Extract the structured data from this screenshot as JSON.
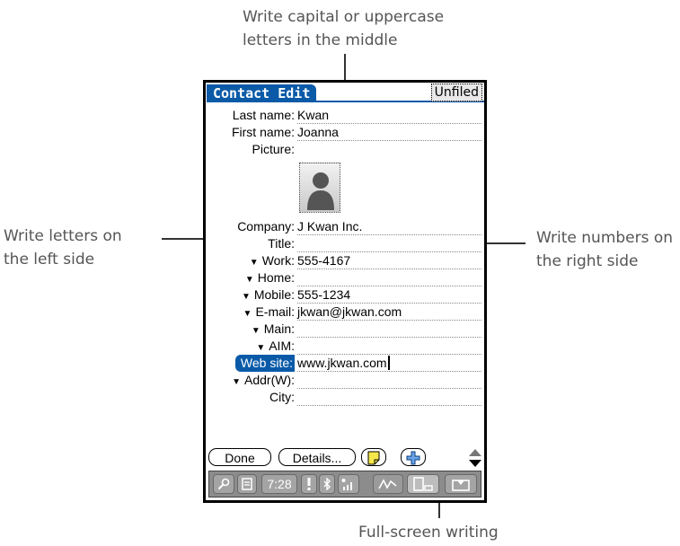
{
  "callouts": {
    "top": "Write capital or uppercase\nletters in the middle",
    "left": "Write letters on\nthe left side",
    "right": "Write numbers on\nthe right side",
    "bottom": "Full-screen writing"
  },
  "header": {
    "title": "Contact Edit",
    "category": "Unfiled"
  },
  "fields": [
    {
      "label": "Last name:",
      "value": "Kwan",
      "dropdown": false
    },
    {
      "label": "First name:",
      "value": "Joanna",
      "dropdown": false
    },
    {
      "label": "Picture:",
      "value": "",
      "dropdown": false
    },
    {
      "label": "Company:",
      "value": "J Kwan Inc.",
      "dropdown": false
    },
    {
      "label": "Title:",
      "value": "",
      "dropdown": false
    },
    {
      "label": "Work:",
      "value": "555-4167",
      "dropdown": true
    },
    {
      "label": "Home:",
      "value": "",
      "dropdown": true
    },
    {
      "label": "Mobile:",
      "value": "555-1234",
      "dropdown": true
    },
    {
      "label": "E-mail:",
      "value": "jkwan@jkwan.com",
      "dropdown": true
    },
    {
      "label": "Main:",
      "value": "",
      "dropdown": true
    },
    {
      "label": "AIM:",
      "value": "",
      "dropdown": true
    },
    {
      "label": "Web site:",
      "value": "www.jkwan.com",
      "dropdown": false,
      "selected": true
    },
    {
      "label": "Addr(W):",
      "value": "",
      "dropdown": true
    },
    {
      "label": "City:",
      "value": "",
      "dropdown": false
    }
  ],
  "buttons": {
    "done": "Done",
    "details": "Details...",
    "note_icon": "note-icon",
    "add_icon": "plus-icon"
  },
  "statusbar": {
    "time": "7:28",
    "icons": [
      "find-icon",
      "menu-icon",
      "alert-icon",
      "bluetooth-icon",
      "signal-icon",
      "graffiti-icon",
      "full-screen-writing-icon",
      "input-area-icon"
    ]
  },
  "colors": {
    "accent": "#0a5aa8",
    "statusbar": "#8c8c8c",
    "callout_text": "#555555"
  }
}
